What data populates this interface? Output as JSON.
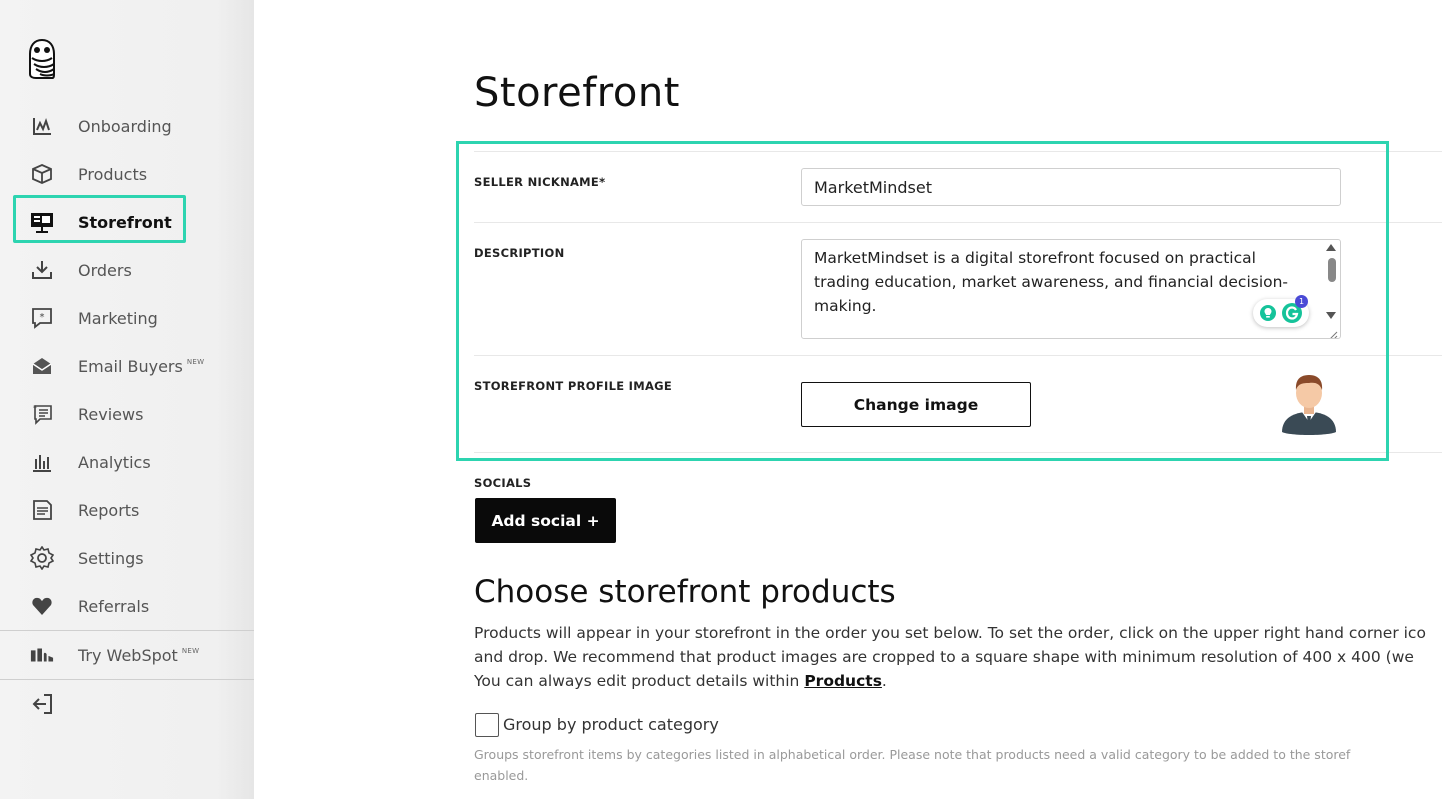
{
  "sidebar": {
    "items": [
      {
        "label": "Onboarding",
        "icon": "onboarding-chart-icon"
      },
      {
        "label": "Products",
        "icon": "box-icon"
      },
      {
        "label": "Storefront",
        "icon": "storefront-monitor-icon"
      },
      {
        "label": "Orders",
        "icon": "download-tray-icon"
      },
      {
        "label": "Marketing",
        "icon": "speech-bubble-star-icon"
      },
      {
        "label": "Email Buyers",
        "icon": "envelope-icon",
        "badge": "NEW"
      },
      {
        "label": "Reviews",
        "icon": "reviews-list-icon"
      },
      {
        "label": "Analytics",
        "icon": "bar-chart-icon"
      },
      {
        "label": "Reports",
        "icon": "document-icon"
      },
      {
        "label": "Settings",
        "icon": "gear-icon"
      },
      {
        "label": "Referrals",
        "icon": "heart-tag-icon"
      }
    ],
    "webspot": {
      "label": "Try WebSpot",
      "badge": "NEW",
      "icon": "webspot-icon"
    },
    "active": "Storefront",
    "accent_color": "#2dd4b0"
  },
  "page": {
    "title": "Storefront"
  },
  "form": {
    "nickname_label": "SELLER NICKNAME*",
    "nickname_value": "MarketMindset",
    "description_label": "DESCRIPTION",
    "description_lines": [
      "MarketMindset is a digital storefront focused on practical",
      "trading education, market awareness, and financial decision-",
      "making."
    ],
    "grammarly_count": "1",
    "profile_image_label": "STOREFRONT PROFILE IMAGE",
    "change_image_label": "Change image",
    "socials_label": "SOCIALS",
    "add_social_label": "Add social +"
  },
  "products_section": {
    "title": "Choose storefront products",
    "paragraph_line1": "Products will appear in your storefront in the order you set below. To set the order, click on the upper right hand corner ico",
    "paragraph_line2": "and drop. We recommend that product images are cropped to a square shape with minimum resolution of 400 x 400 (we",
    "paragraph_line3_prefix": "You can always edit product details within ",
    "paragraph_link": "Products",
    "paragraph_line3_suffix": ".",
    "group_checkbox_label": "Group by product category",
    "help_line1": "Groups storefront items by categories listed in alphabetical order. Please note that products need a valid category to be added to the storef",
    "help_line2": "enabled."
  }
}
